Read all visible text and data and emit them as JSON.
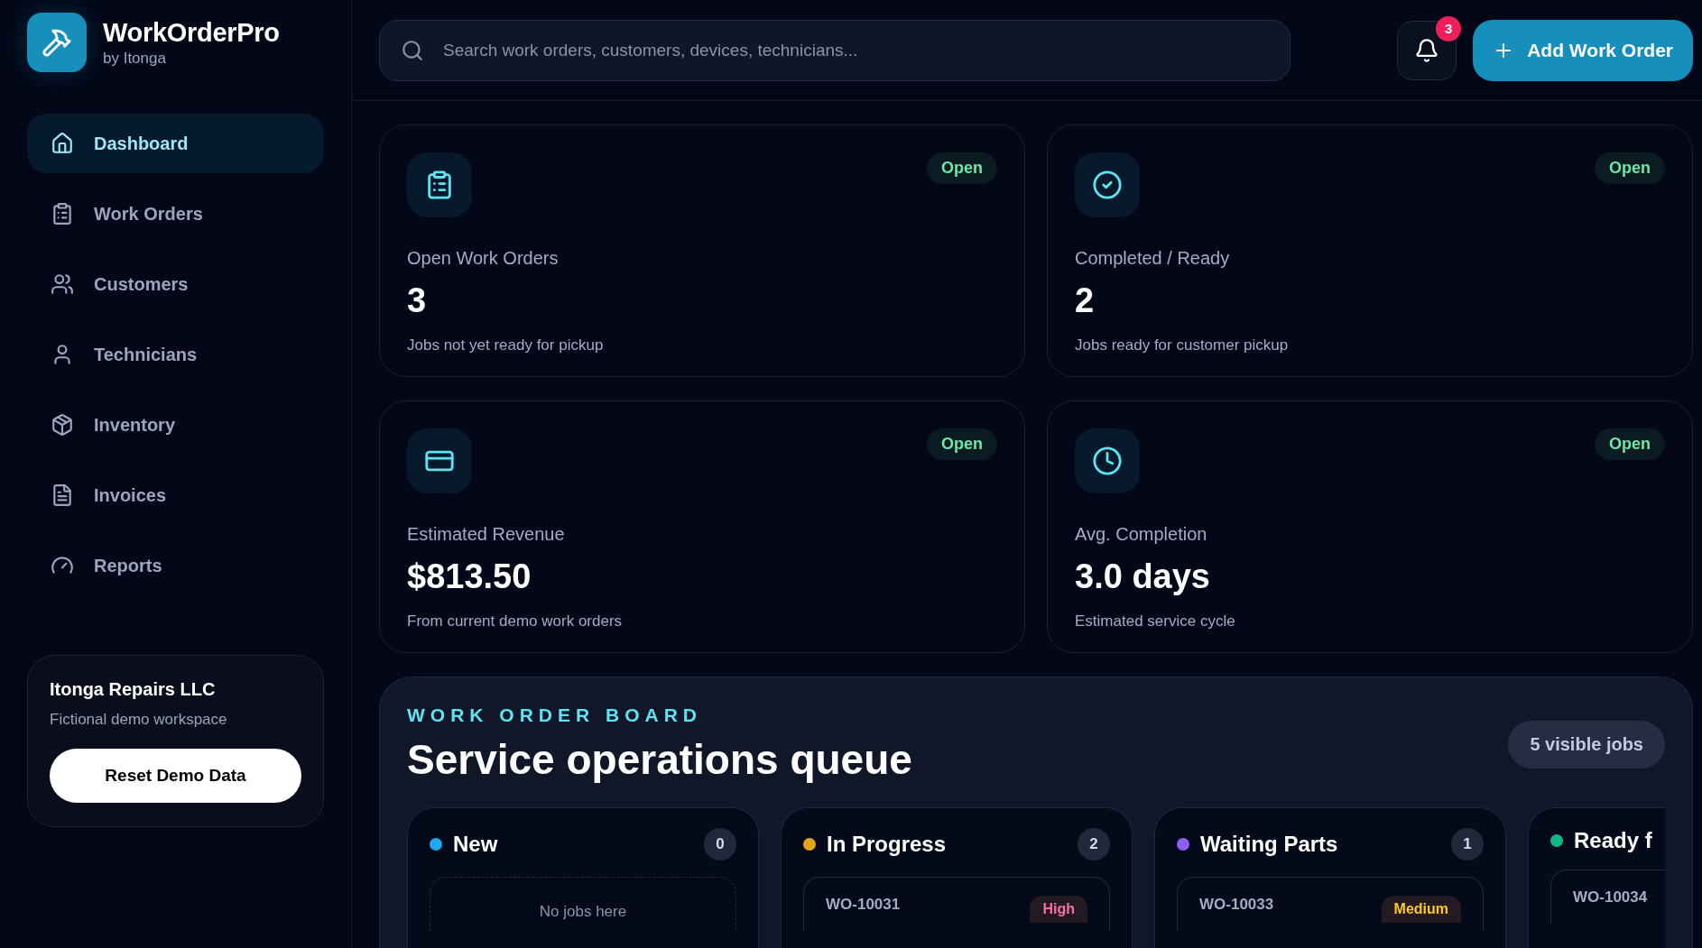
{
  "brand": {
    "name": "WorkOrderPro",
    "byline": "by Itonga"
  },
  "sidebar": {
    "items": [
      {
        "label": "Dashboard",
        "selected": true
      },
      {
        "label": "Work Orders",
        "selected": false
      },
      {
        "label": "Customers",
        "selected": false
      },
      {
        "label": "Technicians",
        "selected": false
      },
      {
        "label": "Inventory",
        "selected": false
      },
      {
        "label": "Invoices",
        "selected": false
      },
      {
        "label": "Reports",
        "selected": false
      }
    ],
    "workspace": {
      "name": "Itonga Repairs LLC",
      "description": "Fictional demo workspace",
      "button": "Reset Demo Data"
    }
  },
  "topbar": {
    "search": {
      "placeholder": "Search work orders, customers, devices, technicians..."
    },
    "notifications": "3",
    "add_button": "Add Work Order"
  },
  "stats": [
    {
      "badge": "Open",
      "label": "Open Work Orders",
      "value": "3",
      "note": "Jobs not yet ready for pickup"
    },
    {
      "badge": "Open",
      "label": "Completed / Ready",
      "value": "2",
      "note": "Jobs ready for customer pickup"
    },
    {
      "badge": "Open",
      "label": "Estimated Revenue",
      "value": "$813.50",
      "note": "From current demo work orders"
    },
    {
      "badge": "Open",
      "label": "Avg. Completion",
      "value": "3.0 days",
      "note": "Estimated service cycle"
    }
  ],
  "board": {
    "eyebrow": "WORK ORDER BOARD",
    "title": "Service operations queue",
    "count": "5 visible jobs",
    "columns": [
      {
        "name": "New",
        "color": "#1ea7f0",
        "count": "0",
        "empty_text": "No jobs here"
      },
      {
        "name": "In Progress",
        "color": "#e7a21b",
        "count": "2",
        "cards": [
          {
            "id": "WO-10031",
            "priority": "High",
            "kind": "high"
          }
        ]
      },
      {
        "name": "Waiting Parts",
        "color": "#8b5cf6",
        "count": "1",
        "cards": [
          {
            "id": "WO-10033",
            "priority": "Medium",
            "kind": "medium"
          }
        ]
      },
      {
        "name": "Ready f",
        "color": "#10b981",
        "cards": [
          {
            "id": "WO-10034"
          }
        ]
      }
    ]
  }
}
